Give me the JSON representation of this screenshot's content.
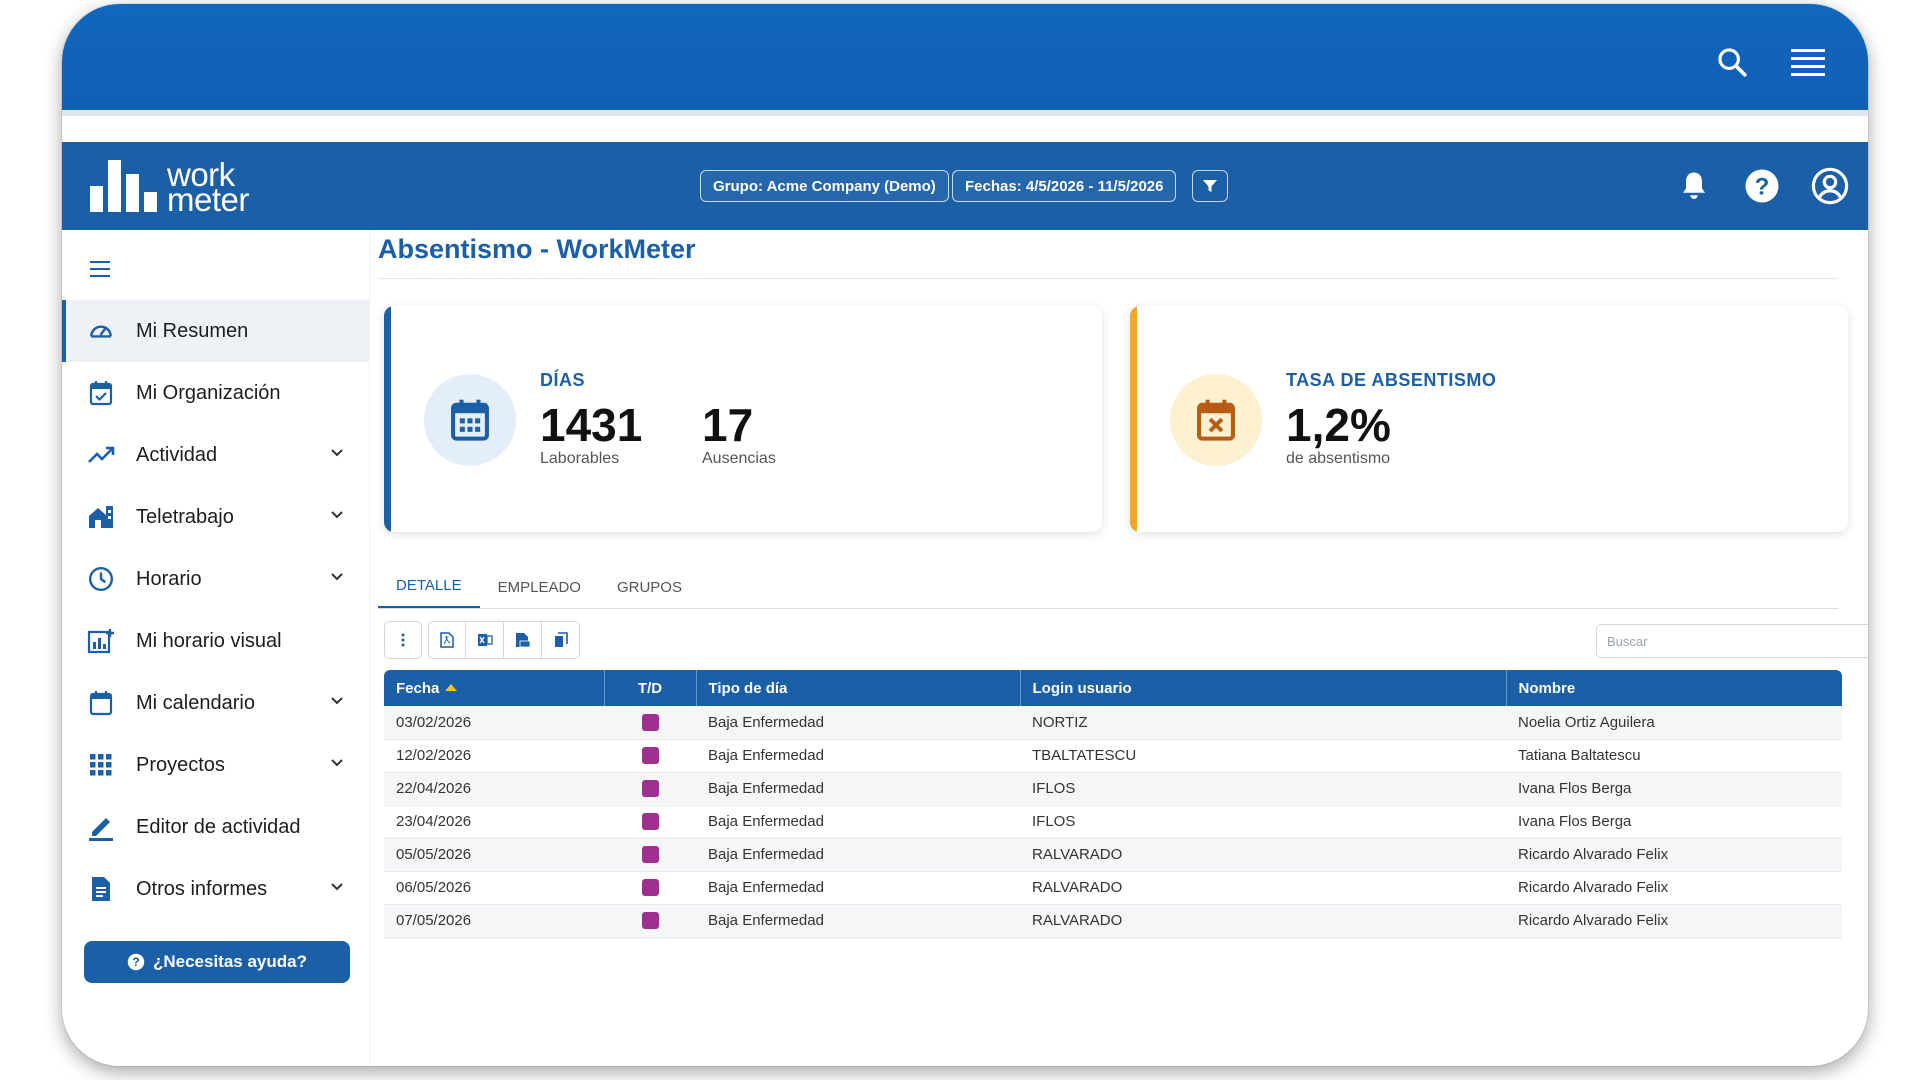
{
  "app": {
    "logo_line1": "work",
    "logo_line2": "meter",
    "group_chip": "Grupo: Acme Company (Demo)",
    "dates_chip": "Fechas: 4/5/2026 - 11/5/2026"
  },
  "icons": {
    "browser_search": "search-icon",
    "browser_menu": "menu-icon",
    "filter": "filter-icon",
    "notifications": "bell-icon",
    "help": "help-icon",
    "account": "user-circle-icon"
  },
  "sidebar": {
    "items": [
      {
        "label": "Mi Resumen",
        "icon": "gauge-icon",
        "active": true,
        "expandable": false
      },
      {
        "label": "Mi Organización",
        "icon": "calendar-check-icon",
        "active": false,
        "expandable": false
      },
      {
        "label": "Actividad",
        "icon": "trend-icon",
        "active": false,
        "expandable": true
      },
      {
        "label": "Teletrabajo",
        "icon": "home-work-icon",
        "active": false,
        "expandable": true
      },
      {
        "label": "Horario",
        "icon": "clock-icon",
        "active": false,
        "expandable": true
      },
      {
        "label": "Mi horario visual",
        "icon": "chart-add-icon",
        "active": false,
        "expandable": false
      },
      {
        "label": "Mi calendario",
        "icon": "calendar-icon",
        "active": false,
        "expandable": true
      },
      {
        "label": "Proyectos",
        "icon": "grid-icon",
        "active": false,
        "expandable": true
      },
      {
        "label": "Editor de actividad",
        "icon": "pencil-icon",
        "active": false,
        "expandable": false
      },
      {
        "label": "Otros informes",
        "icon": "document-icon",
        "active": false,
        "expandable": true
      }
    ],
    "help_button": "¿Necesitas ayuda?"
  },
  "main": {
    "title": "Absentismo - WorkMeter",
    "days_card": {
      "caption": "DÍAS",
      "workdays_value": "1431",
      "workdays_label": "Laborables",
      "absences_value": "17",
      "absences_label": "Ausencias"
    },
    "rate_card": {
      "caption": "TASA DE ABSENTISMO",
      "value": "1,2%",
      "label": "de absentismo"
    },
    "tabs": [
      "DETALLE",
      "EMPLEADO",
      "GRUPOS"
    ],
    "search_placeholder": "Buscar",
    "table": {
      "headers": [
        "Fecha",
        "T/D",
        "Tipo de día",
        "Login usuario",
        "Nombre"
      ],
      "rows": [
        {
          "fecha": "03/02/2026",
          "tipo": "Baja Enfermedad",
          "login": "NORTIZ",
          "nombre": "Noelia Ortiz Aguilera"
        },
        {
          "fecha": "12/02/2026",
          "tipo": "Baja Enfermedad",
          "login": "TBALTATESCU",
          "nombre": "Tatiana Baltatescu"
        },
        {
          "fecha": "22/04/2026",
          "tipo": "Baja Enfermedad",
          "login": "IFLOS",
          "nombre": "Ivana Flos Berga"
        },
        {
          "fecha": "23/04/2026",
          "tipo": "Baja Enfermedad",
          "login": "IFLOS",
          "nombre": "Ivana Flos Berga"
        },
        {
          "fecha": "05/05/2026",
          "tipo": "Baja Enfermedad",
          "login": "RALVARADO",
          "nombre": "Ricardo Alvarado Felix"
        },
        {
          "fecha": "06/05/2026",
          "tipo": "Baja Enfermedad",
          "login": "RALVARADO",
          "nombre": "Ricardo Alvarado Felix"
        },
        {
          "fecha": "07/05/2026",
          "tipo": "Baja Enfermedad",
          "login": "RALVARADO",
          "nombre": "Ricardo Alvarado Felix"
        }
      ]
    }
  },
  "colors": {
    "brand": "#1b5fa7",
    "accent_orange": "#f5a623",
    "day_type_marker": "#a0308f"
  }
}
